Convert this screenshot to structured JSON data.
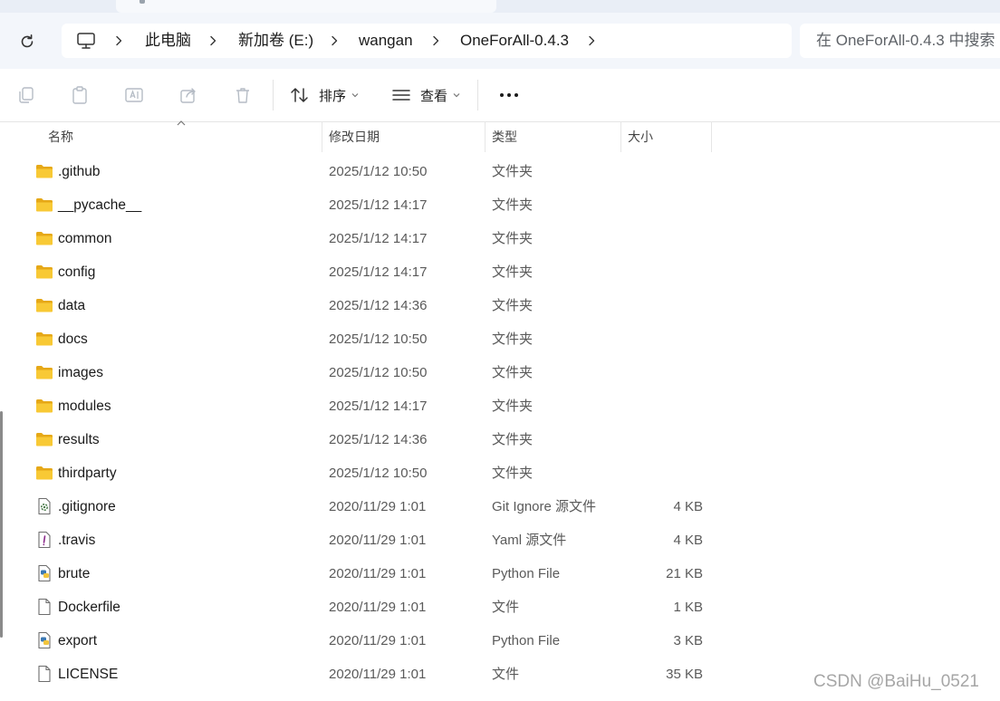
{
  "breadcrumb": {
    "items": [
      "此电脑",
      "新加卷 (E:)",
      "wangan",
      "OneForAll-0.4.3"
    ]
  },
  "search": {
    "placeholder": "在 OneForAll-0.4.3 中搜索"
  },
  "toolbar": {
    "sort_label": "排序",
    "view_label": "查看",
    "more_label": "..."
  },
  "columns": {
    "name": "名称",
    "date": "修改日期",
    "type": "类型",
    "size": "大小"
  },
  "files": [
    {
      "name": ".github",
      "date": "2025/1/12 10:50",
      "type": "文件夹",
      "size": "",
      "icon": "folder-icon"
    },
    {
      "name": "__pycache__",
      "date": "2025/1/12 14:17",
      "type": "文件夹",
      "size": "",
      "icon": "folder-icon"
    },
    {
      "name": "common",
      "date": "2025/1/12 14:17",
      "type": "文件夹",
      "size": "",
      "icon": "folder-icon"
    },
    {
      "name": "config",
      "date": "2025/1/12 14:17",
      "type": "文件夹",
      "size": "",
      "icon": "folder-icon"
    },
    {
      "name": "data",
      "date": "2025/1/12 14:36",
      "type": "文件夹",
      "size": "",
      "icon": "folder-icon"
    },
    {
      "name": "docs",
      "date": "2025/1/12 10:50",
      "type": "文件夹",
      "size": "",
      "icon": "folder-icon"
    },
    {
      "name": "images",
      "date": "2025/1/12 10:50",
      "type": "文件夹",
      "size": "",
      "icon": "folder-icon"
    },
    {
      "name": "modules",
      "date": "2025/1/12 14:17",
      "type": "文件夹",
      "size": "",
      "icon": "folder-icon"
    },
    {
      "name": "results",
      "date": "2025/1/12 14:36",
      "type": "文件夹",
      "size": "",
      "icon": "folder-icon"
    },
    {
      "name": "thirdparty",
      "date": "2025/1/12 10:50",
      "type": "文件夹",
      "size": "",
      "icon": "folder-icon"
    },
    {
      "name": ".gitignore",
      "date": "2020/11/29 1:01",
      "type": "Git Ignore 源文件",
      "size": "4 KB",
      "icon": "settings-file-icon"
    },
    {
      "name": ".travis",
      "date": "2020/11/29 1:01",
      "type": "Yaml 源文件",
      "size": "4 KB",
      "icon": "exclamation-file-icon"
    },
    {
      "name": "brute",
      "date": "2020/11/29 1:01",
      "type": "Python File",
      "size": "21 KB",
      "icon": "python-file-icon"
    },
    {
      "name": "Dockerfile",
      "date": "2020/11/29 1:01",
      "type": "文件",
      "size": "1 KB",
      "icon": "blank-file-icon"
    },
    {
      "name": "export",
      "date": "2020/11/29 1:01",
      "type": "Python File",
      "size": "3 KB",
      "icon": "python-file-icon"
    },
    {
      "name": "LICENSE",
      "date": "2020/11/29 1:01",
      "type": "文件",
      "size": "35 KB",
      "icon": "blank-file-icon"
    }
  ],
  "watermark": "CSDN @BaiHu_0521",
  "colors": {
    "folder": "#f8c935",
    "folder_dark": "#e6a817",
    "address_bg": "#f3f6fb",
    "python_blue": "#3d79b3",
    "python_yellow": "#f2c53d"
  }
}
